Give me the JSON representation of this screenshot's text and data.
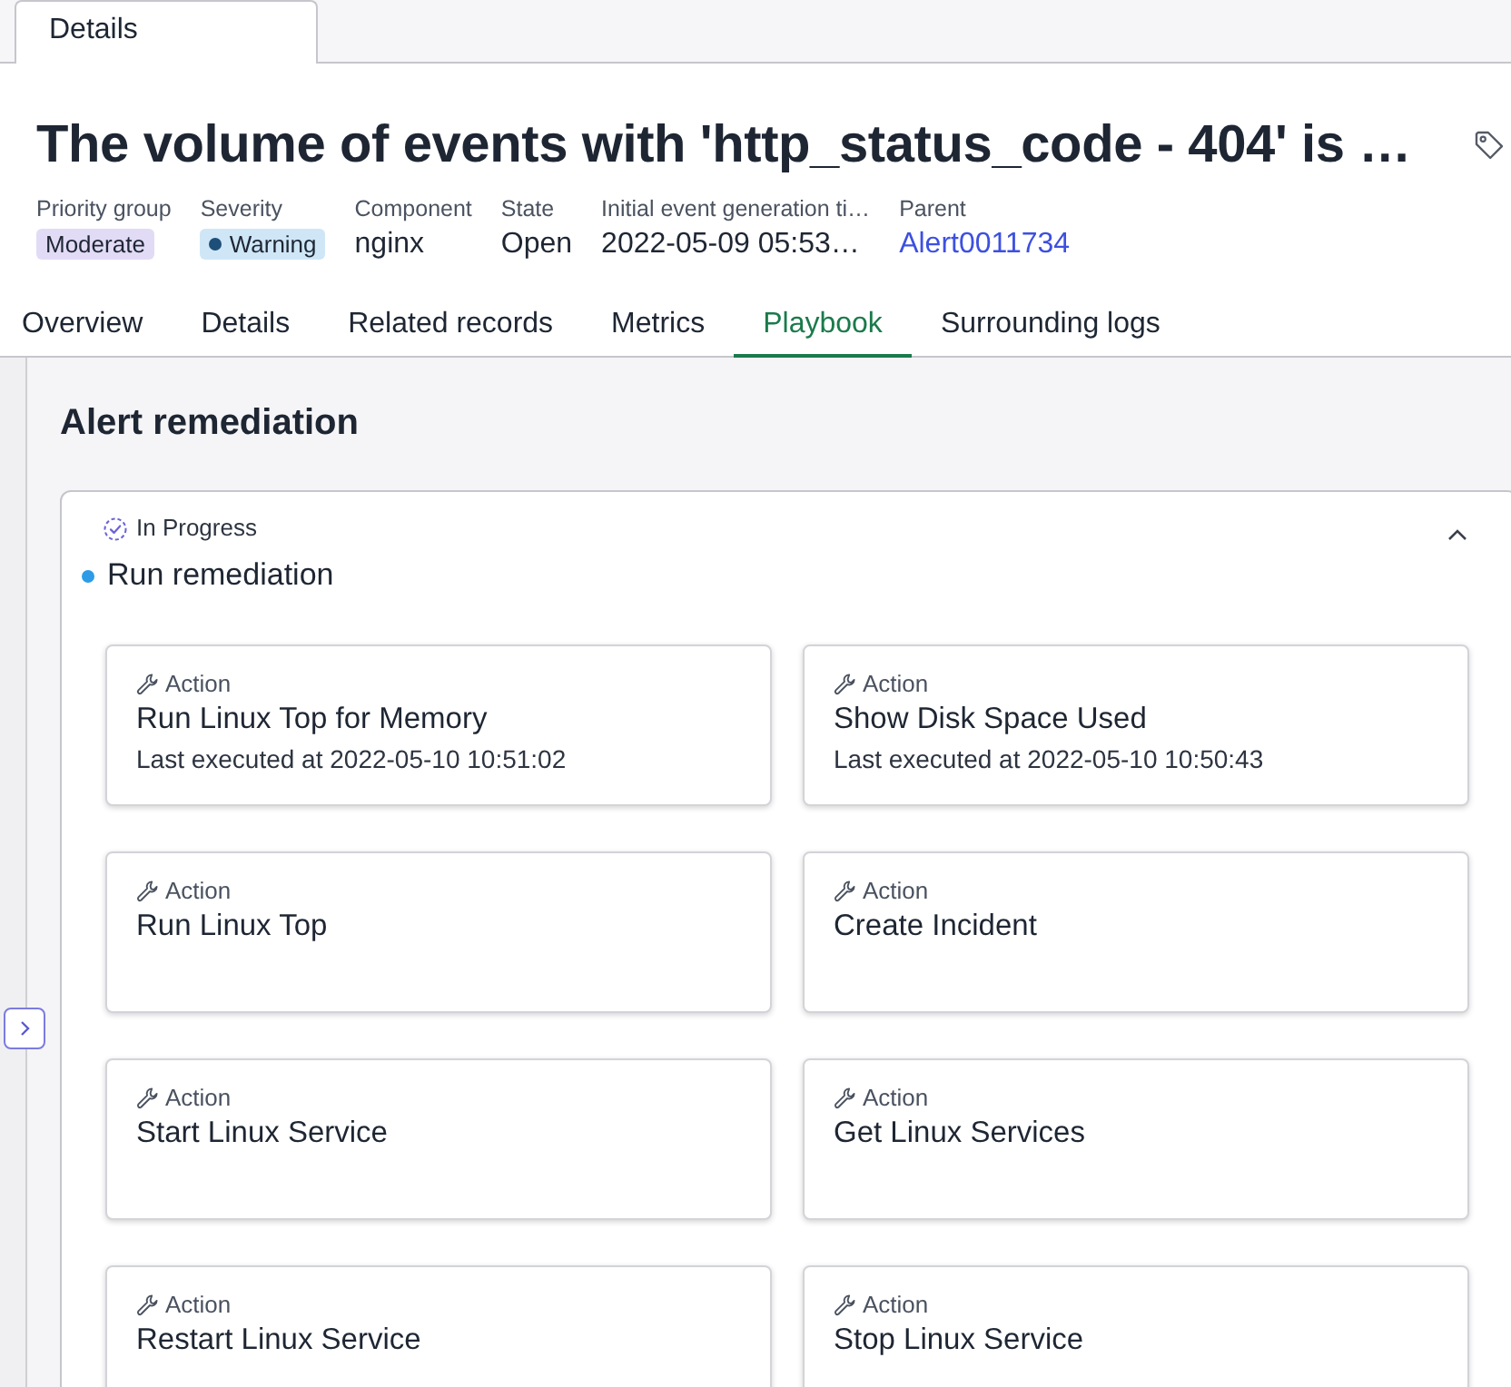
{
  "window_tabs": [
    {
      "label": "Details",
      "selected": true
    }
  ],
  "header": {
    "title": "The volume of events with 'http_status_code - 404' is …"
  },
  "fields": [
    {
      "label": "Priority group",
      "value": "Moderate",
      "kind": "priority_badge"
    },
    {
      "label": "Severity",
      "value": "Warning",
      "kind": "severity_badge"
    },
    {
      "label": "Component",
      "value": "nginx",
      "kind": "text"
    },
    {
      "label": "State",
      "value": "Open",
      "kind": "text"
    },
    {
      "label": "Initial event generation ti…",
      "value": "2022-05-09 05:53…",
      "kind": "text"
    },
    {
      "label": "Parent",
      "value": "Alert0011734",
      "kind": "link"
    }
  ],
  "tabs": [
    {
      "label": "Overview",
      "selected": false
    },
    {
      "label": "Details",
      "selected": false
    },
    {
      "label": "Related records",
      "selected": false
    },
    {
      "label": "Metrics",
      "selected": false
    },
    {
      "label": "Playbook",
      "selected": true
    },
    {
      "label": "Surrounding logs",
      "selected": false
    }
  ],
  "remediation": {
    "title": "Alert remediation",
    "status": "In Progress",
    "step": "Run remediation",
    "expanded": true,
    "actions": [
      {
        "type": "Action",
        "name": "Run Linux Top for Memory",
        "last_executed": "Last executed at 2022-05-10 10:51:02"
      },
      {
        "type": "Action",
        "name": "Show Disk Space Used",
        "last_executed": "Last executed at 2022-05-10 10:50:43"
      },
      {
        "type": "Action",
        "name": "Run Linux Top"
      },
      {
        "type": "Action",
        "name": "Create Incident"
      },
      {
        "type": "Action",
        "name": "Start Linux Service"
      },
      {
        "type": "Action",
        "name": "Get Linux Services"
      },
      {
        "type": "Action",
        "name": "Restart Linux Service"
      },
      {
        "type": "Action",
        "name": "Stop Linux Service"
      }
    ]
  }
}
